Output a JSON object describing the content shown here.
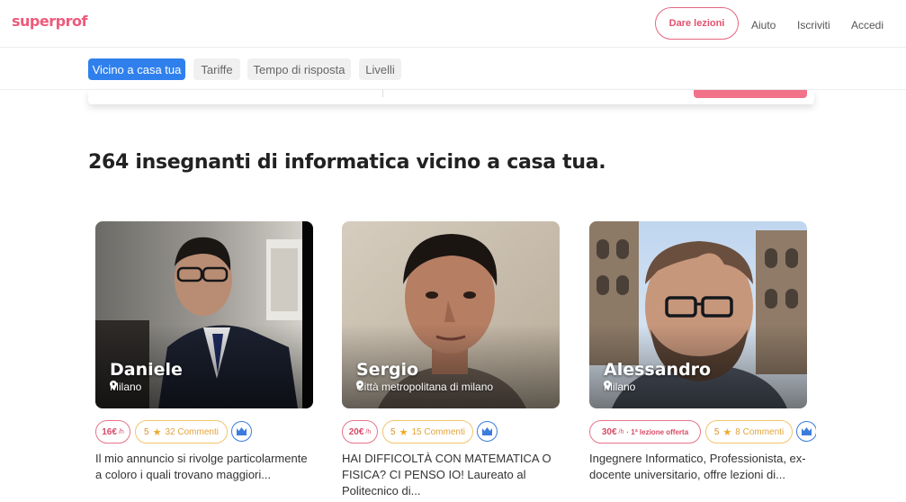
{
  "header": {
    "logo": "superprof",
    "dare_lezioni": "Dare lezioni",
    "aiuto": "Aiuto",
    "iscriviti": "Iscriviti",
    "accedi": "Accedi"
  },
  "filters": [
    "Vicino a casa tua",
    "Tariffe",
    "Tempo di risposta",
    "Livelli"
  ],
  "heading": "264 insegnanti di informatica vicino a casa tua.",
  "cards": [
    {
      "name": "Daniele",
      "location": "Milano",
      "price": "16€",
      "per_hour": "/h",
      "rating": "5",
      "comments": "32 Commenti",
      "description": "Il mio annuncio si rivolge particolarmente a coloro i quali trovano maggiori..."
    },
    {
      "name": "Sergio",
      "location": "Città metropolitana di milano",
      "price": "20€",
      "per_hour": "/h",
      "rating": "5",
      "comments": "15 Commenti",
      "description": "HAI DIFFICOLTÀ CON MATEMATICA O FISICA? CI PENSO IO! Laureato al Politecnico di..."
    },
    {
      "name": "Alessandro",
      "location": "Milano",
      "price": "30€",
      "per_hour": "/h",
      "offer": "· 1ª lezione offerta",
      "rating": "5",
      "comments": "8 Commenti",
      "description": "Ingegnere Informatico, Professionista, ex-docente universitario, offre lezioni di..."
    }
  ],
  "colors": {
    "brand": "#ee5a7b",
    "active_chip": "#2f80ed",
    "rating": "#f0a92a"
  }
}
